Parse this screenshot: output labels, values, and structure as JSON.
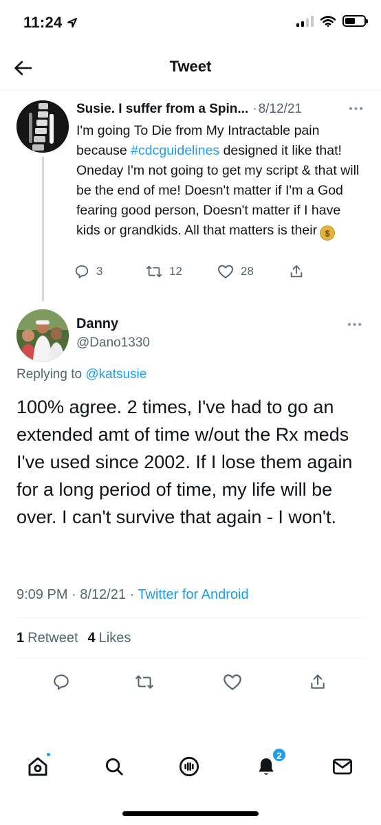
{
  "status_bar": {
    "time": "11:24",
    "battery_level": 0.55
  },
  "header": {
    "title": "Tweet"
  },
  "parent_tweet": {
    "author_name": "Susie. I suffer from a Spin...",
    "separator": "·",
    "date": "8/12/21",
    "text_before_hashtag": "I'm going To Die from My Intractable pain because ",
    "hashtag": "#cdcguidelines",
    "text_after_hashtag": " designed it like that! Oneday I'm not going to get my script & that will be the end of me! Doesn't matter if I'm a God fearing good person, Doesn't matter if I have kids or grandkids. All that matters is their",
    "emoji": "$",
    "replies": "3",
    "retweets": "12",
    "likes": "28"
  },
  "main_tweet": {
    "author_name": "Danny",
    "handle": "@Dano1330",
    "replying_prefix": "Replying to ",
    "replying_to": "@katsusie",
    "text": "100% agree. 2 times, I've had to go an extended amt of time w/out the Rx meds I've used since 2002. If I lose them again for a long period of time, my life will be over. I can't survive that again - I won't.",
    "time": "9:09 PM · 8/12/21 ·",
    "source": "Twitter for Android",
    "retweet_count": "1",
    "retweet_label": "Retweet",
    "like_count": "4",
    "like_label": "Likes"
  },
  "bottom_nav": {
    "notifications_badge": "2"
  },
  "colors": {
    "accent": "#1d9bf0",
    "secondary_text": "#536471",
    "text": "#0f1419"
  }
}
